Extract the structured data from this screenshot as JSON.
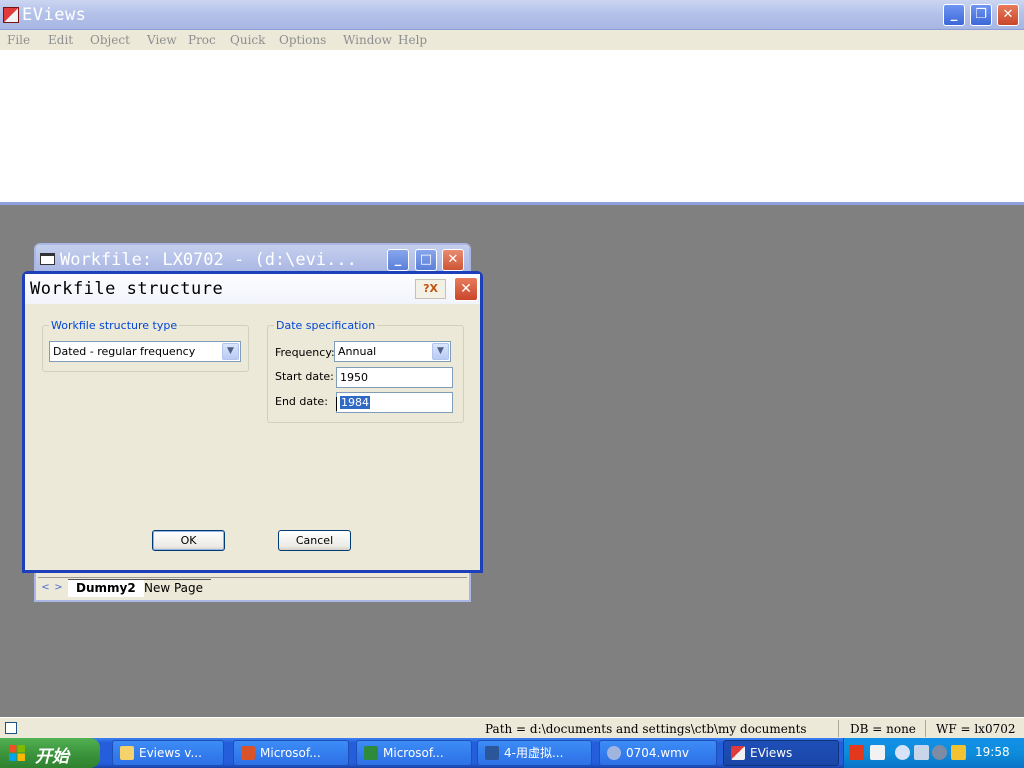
{
  "app": {
    "title": "EViews",
    "window_buttons": {
      "minimize": "_",
      "restore": "❐",
      "close": "✕"
    }
  },
  "menu": [
    "File",
    "Edit",
    "Object",
    "View",
    "Proc",
    "Quick",
    "Options",
    "Window",
    "Help"
  ],
  "workfile_window": {
    "title": "Workfile: LX0702 - (d:\\evi...",
    "tabs": [
      "Dummy2",
      "New Page"
    ]
  },
  "dialog": {
    "title": "Workfile structure",
    "structure_group_label": "Workfile structure type",
    "structure_type_value": "Dated - regular frequency",
    "date_group_label": "Date specification",
    "frequency_label": "Frequency:",
    "frequency_value": "Annual",
    "start_label": "Start date:",
    "start_value": "1950",
    "end_label": "End date:",
    "end_value": "1984",
    "ok_label": "OK",
    "cancel_label": "Cancel"
  },
  "statusbar": {
    "path": "Path = d:\\documents and settings\\ctb\\my documents",
    "db": "DB = none",
    "wf": "WF = lx0702"
  },
  "taskbar": {
    "start_label": "开始",
    "tasks": [
      "Eviews v...",
      "Microsof...",
      "Microsof...",
      "4-用虚拟...",
      "0704.wmv",
      "EViews"
    ],
    "clock": "19:58"
  }
}
